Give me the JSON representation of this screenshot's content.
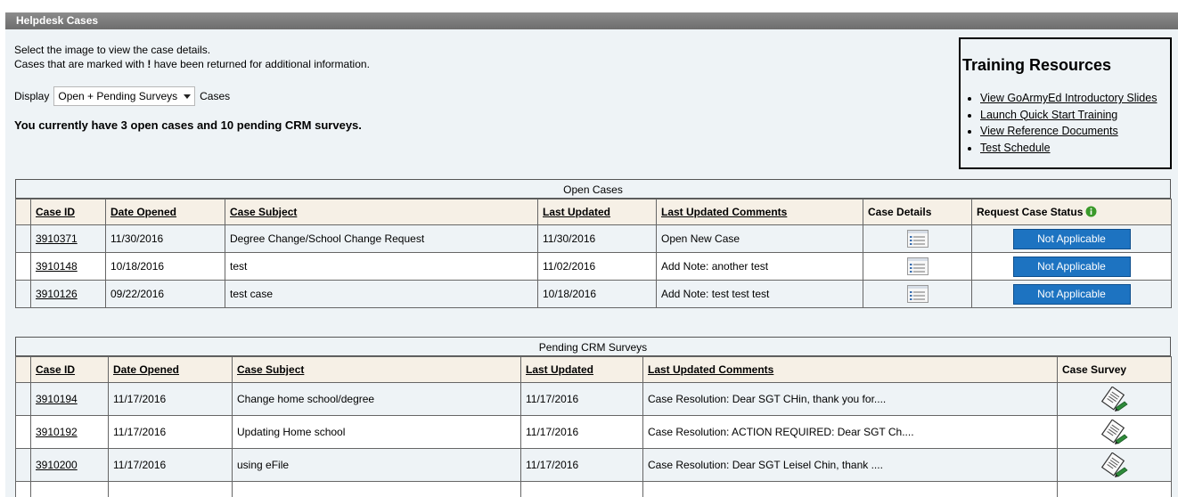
{
  "panel": {
    "title": "Helpdesk Cases"
  },
  "intro": {
    "line1": "Select the image to view the case details.",
    "line2_before": "Cases that are marked with ",
    "line2_marker": "!",
    "line2_after": " have been returned for additional information."
  },
  "display": {
    "label": "Display",
    "selected": "Open + Pending Surveys",
    "suffix": "Cases"
  },
  "summary": "You currently have 3 open cases and 10 pending CRM surveys.",
  "training": {
    "title": "Training Resources",
    "links": [
      "View GoArmyEd Introductory Slides",
      "Launch Quick Start Training",
      "View Reference Documents",
      "Test Schedule"
    ]
  },
  "open_cases": {
    "caption": "Open Cases",
    "headers": {
      "case_id": "Case ID",
      "date_opened": "Date Opened",
      "case_subject": "Case Subject",
      "last_updated": "Last Updated",
      "last_comments": "Last Updated Comments",
      "case_details": "Case Details",
      "request_status": "Request Case Status"
    },
    "rows": [
      {
        "id": "3910371",
        "opened": "11/30/2016",
        "subject": "Degree Change/School Change Request",
        "updated": "11/30/2016",
        "comments": "Open New Case",
        "status": "Not Applicable"
      },
      {
        "id": "3910148",
        "opened": "10/18/2016",
        "subject": "test",
        "updated": "11/02/2016",
        "comments": "Add Note: another test",
        "status": "Not Applicable"
      },
      {
        "id": "3910126",
        "opened": "09/22/2016",
        "subject": "test case",
        "updated": "10/18/2016",
        "comments": "Add Note: test test test",
        "status": "Not Applicable"
      }
    ]
  },
  "pending_surveys": {
    "caption": "Pending CRM Surveys",
    "headers": {
      "case_id": "Case ID",
      "date_opened": "Date Opened",
      "case_subject": "Case Subject",
      "last_updated": "Last Updated",
      "last_comments": "Last Updated Comments",
      "case_survey": "Case Survey"
    },
    "rows": [
      {
        "id": "3910194",
        "opened": "11/17/2016",
        "subject": "Change home school/degree",
        "updated": "11/17/2016",
        "comments": "Case Resolution: Dear SGT CHin, thank you for...."
      },
      {
        "id": "3910192",
        "opened": "11/17/2016",
        "subject": "Updating Home school",
        "updated": "11/17/2016",
        "comments": "Case Resolution: ACTION REQUIRED: Dear SGT Ch...."
      },
      {
        "id": "3910200",
        "opened": "11/17/2016",
        "subject": "using eFile",
        "updated": "11/17/2016",
        "comments": "Case Resolution: Dear SGT Leisel Chin, thank ...."
      }
    ]
  },
  "colors": {
    "button": "#1d73c1",
    "header_bg": "#f6f0e6",
    "panel_bg": "#eef3f6",
    "titlebar": "#7a7a7a",
    "info": "#3a9a2a"
  },
  "icons": {
    "details": "document-list-icon",
    "survey": "survey-pencil-icon",
    "info": "info-icon",
    "dropdown": "chevron-down-icon"
  }
}
